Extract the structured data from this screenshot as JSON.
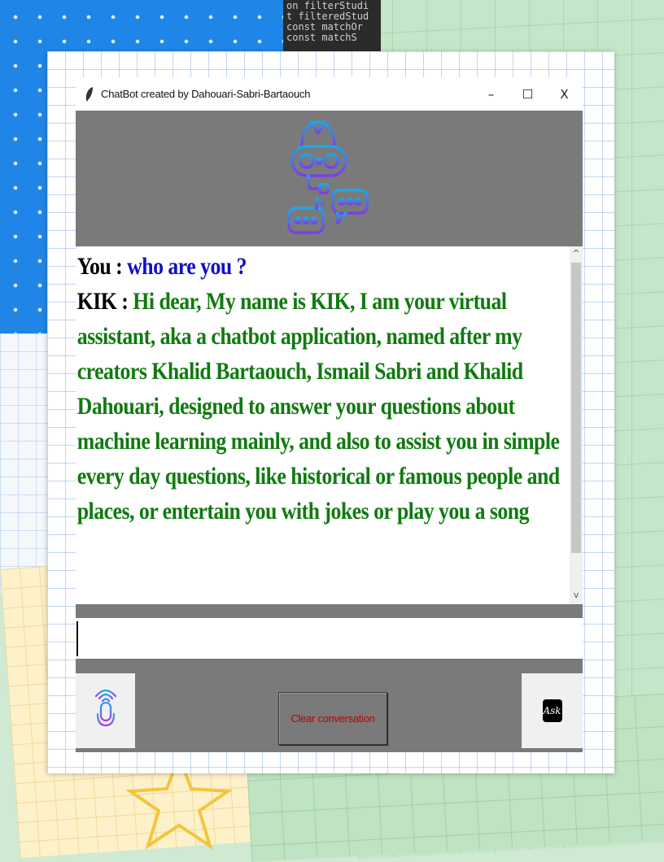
{
  "window": {
    "title": "ChatBot created by Dahouari-Sabri-Bartaouch",
    "controls": {
      "minimize": "–",
      "maximize": "☐",
      "close": "X"
    }
  },
  "background": {
    "code_lines": "on filterStudi\nt filteredStud\nconst matchOr\nconst matchS"
  },
  "chat": {
    "user_label": "You :",
    "user_message": "who are you ?",
    "bot_label": "KIK :",
    "bot_message": "Hi dear, My name is KIK, I am your virtual assistant, aka a chatbot application, named after my creators Khalid Bartaouch, Ismail Sabri and Khalid Dahouari, designed to answer your questions about machine learning mainly, and also to assist you in simple every day questions, like historical or famous people and places, or entertain you with jokes or play you a song"
  },
  "scrollbar": {
    "up": "^",
    "down": "v"
  },
  "input": {
    "value": ""
  },
  "buttons": {
    "clear": "Clear conversation",
    "ask": "Ask"
  },
  "colors": {
    "panel_gray": "#7a7a7a",
    "user_text": "#1010c8",
    "bot_text": "#107a10",
    "clear_text": "#c00000"
  },
  "icons": {
    "header": "robot-chat-logo-icon",
    "mic": "microphone-icon",
    "ask": "ask-icon",
    "app": "feather-icon"
  }
}
